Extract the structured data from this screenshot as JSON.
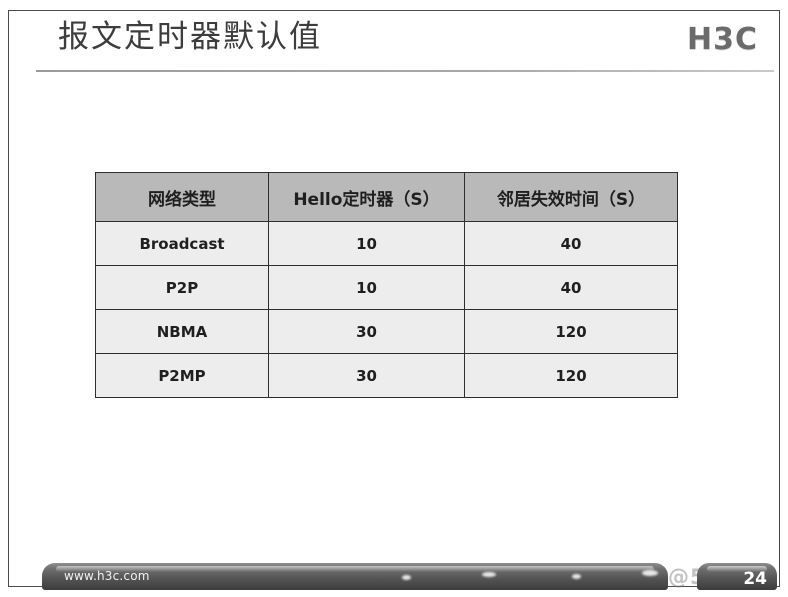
{
  "slide": {
    "title": "报文定时器默认值",
    "logo": "H3C",
    "page_number": "24",
    "footer_url": "www.h3c.com",
    "watermark": "@51",
    "colors": {
      "header_row_bg": "#b9b9b9",
      "data_row_bg": "#ededed",
      "border": "#2e2e2e",
      "title_text": "#3d3d3d",
      "footer_bar": "#565656"
    }
  },
  "table": {
    "headers": [
      "网络类型",
      "Hello定时器（S）",
      "邻居失效时间（S）"
    ],
    "rows": [
      {
        "type": "Broadcast",
        "hello": "10",
        "dead": "40"
      },
      {
        "type": "P2P",
        "hello": "10",
        "dead": "40"
      },
      {
        "type": "NBMA",
        "hello": "30",
        "dead": "120"
      },
      {
        "type": "P2MP",
        "hello": "30",
        "dead": "120"
      }
    ]
  }
}
